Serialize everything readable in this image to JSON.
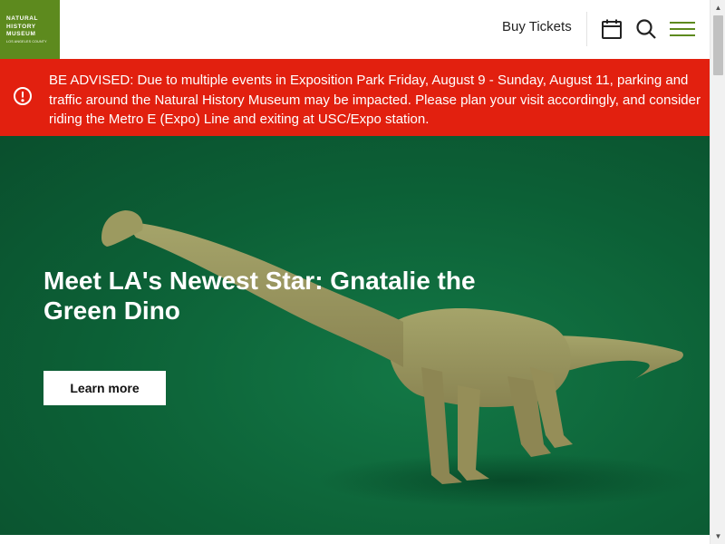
{
  "logo": {
    "lines": [
      "NATURAL",
      "HISTORY",
      "MUSEUM"
    ],
    "subline": "LOS ANGELES COUNTY"
  },
  "header": {
    "buy_tickets": "Buy Tickets",
    "icons": [
      "calendar-icon",
      "search-icon",
      "hamburger-menu-icon"
    ]
  },
  "alert": {
    "text": "BE ADVISED: Due to multiple events in Exposition Park Friday, August 9 - Sunday, August 11, parking and traffic around the Natural History Museum may be impacted. Please plan your visit accordingly, and consider riding the Metro E (Expo) Line and exiting at USC/Expo station.",
    "icon": "alert-circle-icon"
  },
  "hero": {
    "title": "Meet LA's Newest Star: Gnatalie the Green Dino",
    "button": "Learn more"
  },
  "colors": {
    "brand_green": "#5d8a1e",
    "alert_red": "#e2200f",
    "hero_green": "#0c6036",
    "menu_green": "#5d8a1e"
  }
}
